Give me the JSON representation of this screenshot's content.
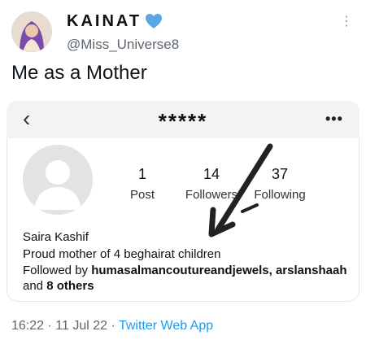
{
  "tweet": {
    "author_name": "KAINAT",
    "handle": "@Miss_Universe8",
    "text": "Me as a Mother",
    "timestamp": "16:22 · 11 Jul 22 · ",
    "app": "Twitter Web App"
  },
  "profile": {
    "username_masked": "*****",
    "posts_count": "1",
    "posts_label": "Post",
    "followers_count": "14",
    "followers_label": "Followers",
    "following_count": "37",
    "following_label": "Following",
    "name": "Saira Kashif",
    "bio": "Proud mother of 4 beghairat children",
    "followed_by_prefix": "Followed by ",
    "followed_by_users": "humasalmancoutureandjewels, arslanshaah",
    "followed_by_and": "and ",
    "followed_by_others": "8 others"
  },
  "colors": {
    "verified_badge": "#5aa7e8",
    "link": "#1d9bf0",
    "secondary_text": "#5b6671"
  },
  "icons": [
    "verified-icon",
    "more-icon",
    "back-icon",
    "options-icon",
    "default-avatar-icon"
  ]
}
